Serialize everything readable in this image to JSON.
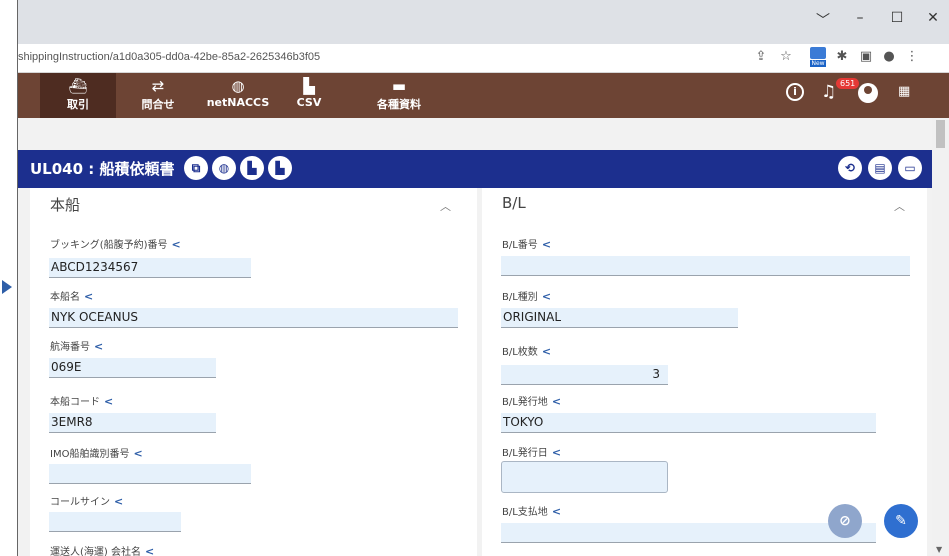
{
  "browser": {
    "window_controls": {
      "chevron": "﹀",
      "minimize": "–",
      "maximize": "☐",
      "close": "✕"
    },
    "url": "shippingInstruction/a1d0a305-dd0a-42be-85a2-2625346b3f05",
    "toolbar_icons": [
      "share-icon",
      "star-icon",
      "new-extension-icon",
      "puzzle-icon",
      "sidebar-icon",
      "profile-icon",
      "menu-icon"
    ],
    "new_badge": "New"
  },
  "nav": {
    "items": [
      {
        "icon": "ship-icon",
        "label": "取引"
      },
      {
        "icon": "exchange-icon",
        "label": "問合せ"
      },
      {
        "icon": "globe-icon",
        "label": "netNACCS"
      },
      {
        "icon": "file-icon",
        "label": "CSV"
      },
      {
        "icon": "folder-icon",
        "label": "各種資料"
      }
    ],
    "notification_count": "651",
    "info_glyph": "i"
  },
  "screen": {
    "title": "UL040 : 船積依頼書"
  },
  "left_section": {
    "title": "本船",
    "fields": [
      {
        "label": "ブッキング(船腹予約)番号",
        "value": "ABCD1234567"
      },
      {
        "label": "本船名",
        "value": "NYK OCEANUS"
      },
      {
        "label": "航海番号",
        "value": "069E"
      },
      {
        "label": "本船コード",
        "value": "3EMR8"
      },
      {
        "label": "IMO船舶識別番号",
        "value": ""
      },
      {
        "label": "コールサイン",
        "value": ""
      },
      {
        "label": "運送人(海運) 会社名",
        "value": ""
      }
    ]
  },
  "right_section": {
    "title": "B/L",
    "fields": [
      {
        "label": "B/L番号",
        "value": ""
      },
      {
        "label": "B/L種別",
        "value": "ORIGINAL"
      },
      {
        "label": "B/L枚数",
        "value": "3"
      },
      {
        "label": "B/L発行地",
        "value": "TOKYO"
      },
      {
        "label": "B/L発行日",
        "value": ""
      },
      {
        "label": "B/L支払地",
        "value": ""
      }
    ]
  },
  "colors": {
    "nav_bg": "#6d4434",
    "header_bg": "#1c2f8e",
    "input_bg": "#e6f1fb",
    "fab_attach": "#8fa6cc",
    "fab_edit": "#2f6fd0"
  }
}
